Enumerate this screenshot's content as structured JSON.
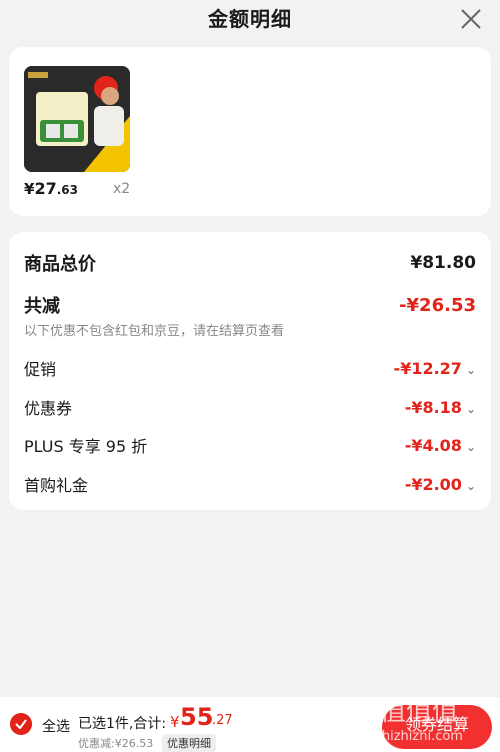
{
  "header": {
    "title": "金额明细"
  },
  "product": {
    "price_symbol": "¥",
    "price_int": "27",
    "price_dec": ".63",
    "quantity": "x2"
  },
  "summary": {
    "total_label": "商品总价",
    "total_value": "¥81.80",
    "reduce_label": "共减",
    "reduce_value": "-¥26.53",
    "note": "以下优惠不包含红包和京豆，请在结算页查看",
    "items": [
      {
        "label": "促销",
        "value": "-¥12.27"
      },
      {
        "label": "优惠券",
        "value": "-¥8.18"
      },
      {
        "label": "PLUS 专享 95 折",
        "value": "-¥4.08"
      },
      {
        "label": "首购礼金",
        "value": "-¥2.00"
      }
    ]
  },
  "bottom_bar": {
    "select_all": "全选",
    "selected": "已选1件,合计:",
    "total_symbol": "¥",
    "total_int": "55",
    "total_dec": ".27",
    "discount": "优惠减:¥26.53",
    "detail_link": "优惠明细",
    "checkout": "领券结算"
  },
  "watermark": "值值值",
  "watermark_url": "zhizhizhi.com",
  "colors": {
    "accent": "#e2231a",
    "button": "#f23030"
  }
}
